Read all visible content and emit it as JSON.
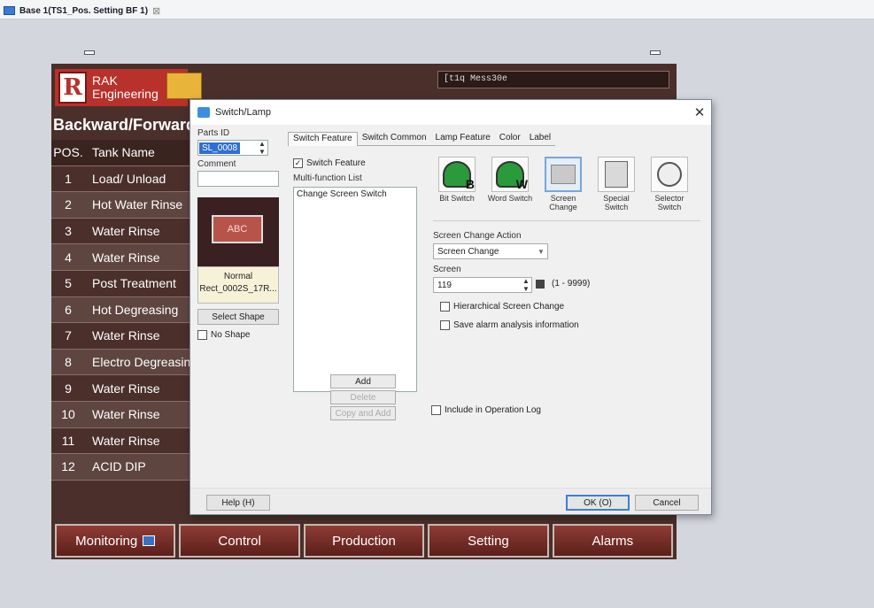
{
  "doc_tab": {
    "title": "Base 1(TS1_Pos. Setting BF 1)",
    "close_glyph": "⊠"
  },
  "hmi": {
    "logo_text_line1": "RAK",
    "logo_text_line2": "Engineering",
    "logo_letter": "R",
    "status_text": "[t1q  Mess30e",
    "title": "Backward/Forward",
    "table_header": {
      "pos": "POS.",
      "name": "Tank Name"
    },
    "rows": [
      {
        "pos": "1",
        "name": "Load/ Unload"
      },
      {
        "pos": "2",
        "name": "Hot Water Rinse"
      },
      {
        "pos": "3",
        "name": "Water Rinse"
      },
      {
        "pos": "4",
        "name": "Water Rinse"
      },
      {
        "pos": "5",
        "name": "Post Treatment"
      },
      {
        "pos": "6",
        "name": "Hot Degreasing"
      },
      {
        "pos": "7",
        "name": "Water Rinse"
      },
      {
        "pos": "8",
        "name": "Electro Degreasin"
      },
      {
        "pos": "9",
        "name": "Water Rinse"
      },
      {
        "pos": "10",
        "name": "Water Rinse"
      },
      {
        "pos": "11",
        "name": "Water Rinse"
      },
      {
        "pos": "12",
        "name": "ACID DIP"
      }
    ],
    "nav": {
      "monitoring": "Monitoring",
      "control": "Control",
      "production": "Production",
      "setting": "Setting",
      "alarms": "Alarms"
    }
  },
  "dialog": {
    "title": "Switch/Lamp",
    "close": "✕",
    "parts_id_label": "Parts ID",
    "parts_id_value": "SL_0008",
    "comment_label": "Comment",
    "comment_value": "",
    "preview_text": "ABC",
    "preview_state": "Normal",
    "preview_shape": "Rect_0002S_17R...",
    "select_shape": "Select Shape",
    "no_shape": "No Shape",
    "tabs": [
      "Switch Feature",
      "Switch Common",
      "Lamp Feature",
      "Color",
      "Label"
    ],
    "switch_feature_checkbox": "Switch Feature",
    "multi_function_list_label": "Multi-function List",
    "multi_function_items": [
      "Change Screen Switch"
    ],
    "add": "Add",
    "delete": "Delete",
    "copy_and_add": "Copy and Add",
    "switch_types": [
      {
        "label": "Bit Switch",
        "icon": "bit-switch-icon",
        "letter": "B"
      },
      {
        "label": "Word Switch",
        "icon": "word-switch-icon",
        "letter": "W"
      },
      {
        "label": "Screen Change",
        "icon": "screen-change-icon",
        "letter": ""
      },
      {
        "label": "Special Switch",
        "icon": "special-switch-icon",
        "letter": ""
      },
      {
        "label": "Selector Switch",
        "icon": "selector-switch-icon",
        "letter": ""
      }
    ],
    "screen_change_action_label": "Screen Change Action",
    "screen_change_action_value": "Screen Change",
    "screen_label": "Screen",
    "screen_value": "119",
    "screen_range": "(1 - 9999)",
    "hierarchical_screen_change": "Hierarchical Screen Change",
    "save_alarm": "Save alarm analysis information",
    "include_operation_log": "Include in Operation Log",
    "help": "Help (H)",
    "ok": "OK (O)",
    "cancel": "Cancel"
  }
}
